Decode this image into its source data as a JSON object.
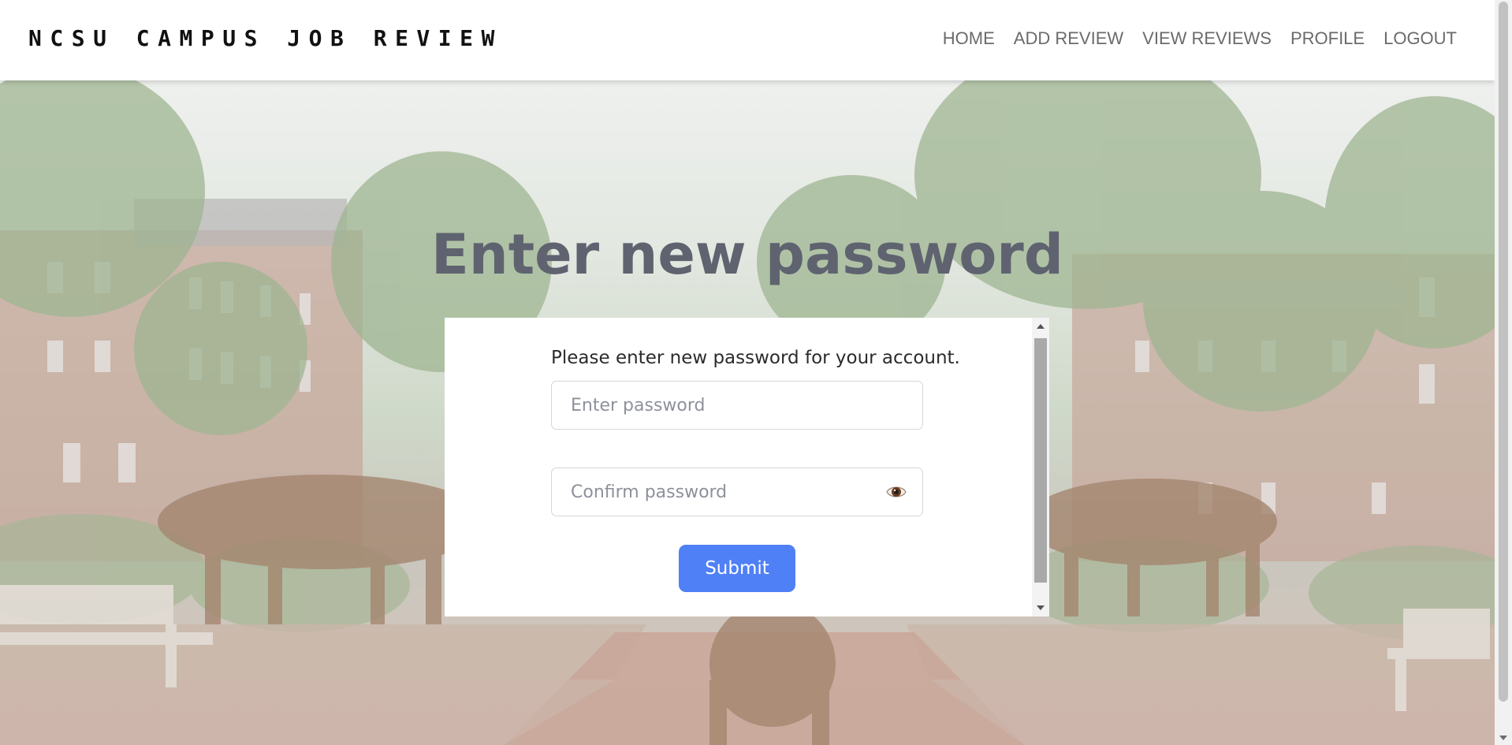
{
  "navbar": {
    "brand": "NCSU CAMPUS JOB REVIEW",
    "links": [
      "HOME",
      "ADD REVIEW",
      "VIEW REVIEWS",
      "PROFILE",
      "LOGOUT"
    ]
  },
  "page": {
    "title": "Enter new password",
    "instruction": "Please enter new password for your account.",
    "password_placeholder": "Enter password",
    "confirm_placeholder": "Confirm password",
    "submit_label": "Submit"
  },
  "icons": {
    "eye": "eye-icon"
  },
  "colors": {
    "accent": "#4f80f6",
    "title": "#5f6370",
    "nav_text": "#6b6b6b"
  }
}
